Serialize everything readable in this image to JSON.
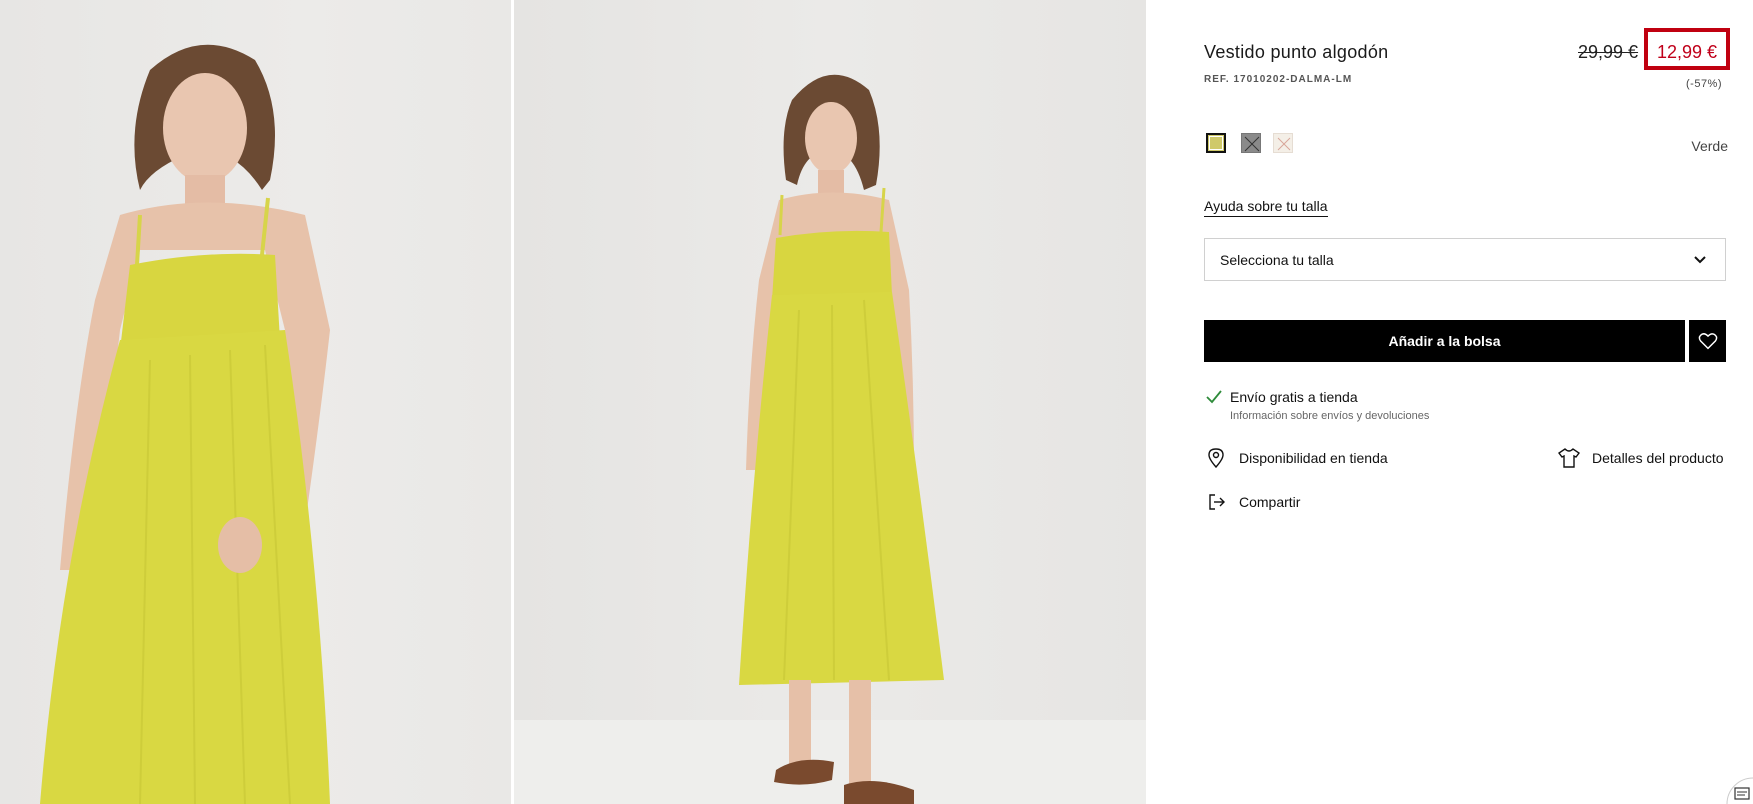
{
  "product": {
    "title": "Vestido punto algodón",
    "ref": "REF. 17010202-DALMA-LM",
    "old_price": "29,99 €",
    "new_price": "12,99 €",
    "discount": "(-57%)",
    "color_name": "Verde",
    "colors": [
      "#cfc96a",
      "#8a8a8a",
      "#f4efe7"
    ]
  },
  "size": {
    "help_link": "Ayuda sobre tu talla",
    "select_placeholder": "Selecciona tu talla"
  },
  "actions": {
    "add_to_bag": "Añadir a la bolsa"
  },
  "shipping": {
    "title": "Envío gratis a tienda",
    "info": "Información sobre envíos y devoluciones"
  },
  "links": {
    "store_availability": "Disponibilidad en tienda",
    "product_details": "Detalles del producto",
    "share": "Compartir"
  },
  "icons": {
    "check": "check-icon",
    "location": "location-pin-icon",
    "shirt": "tshirt-icon",
    "share": "share-icon",
    "heart": "heart-icon",
    "chevron": "chevron-down-icon"
  }
}
